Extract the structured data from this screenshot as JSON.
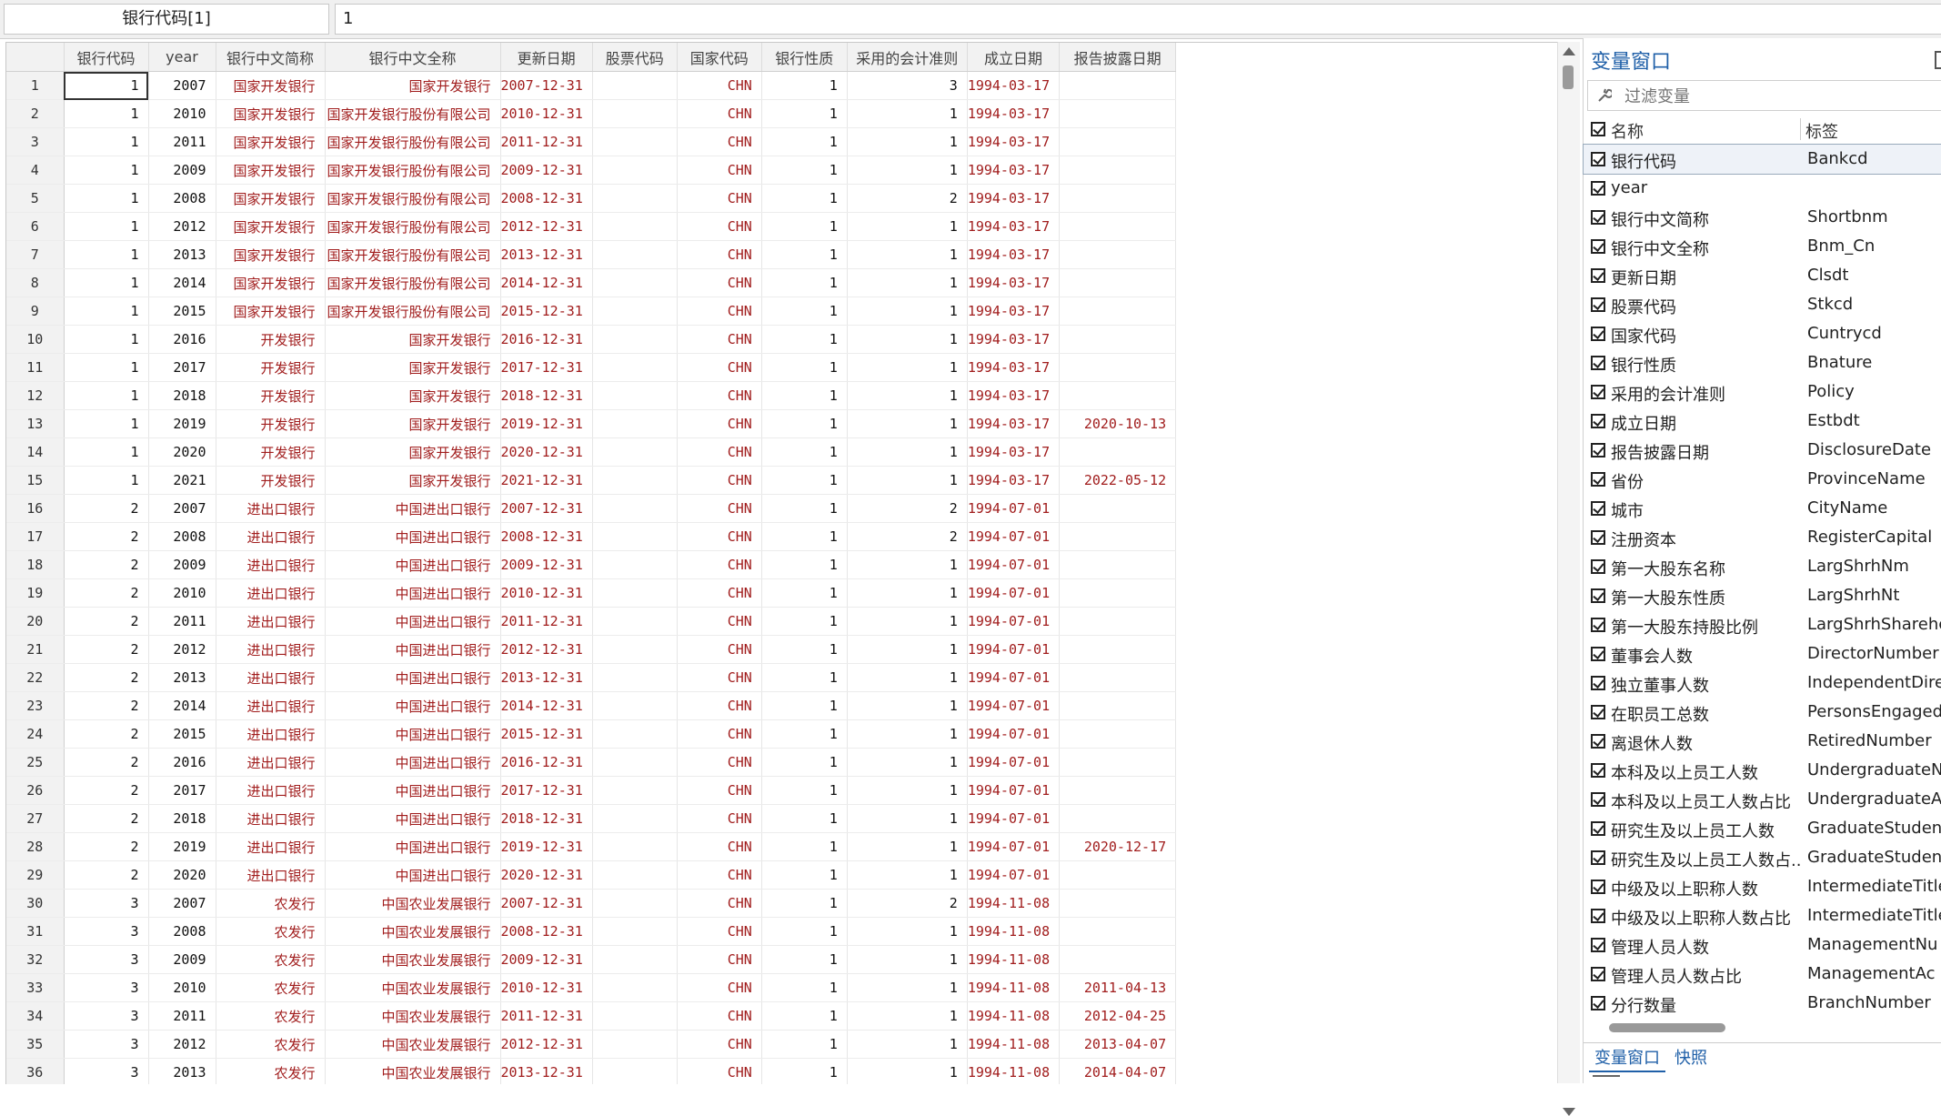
{
  "varbar": {
    "name": "银行代码[1]",
    "value": "1"
  },
  "columns": [
    "银行代码",
    "year",
    "银行中文简称",
    "银行中文全称",
    "更新日期",
    "股票代码",
    "国家代码",
    "银行性质",
    "采用的会计准则",
    "成立日期",
    "报告披露日期"
  ],
  "rows": [
    [
      "1",
      "1",
      "2007",
      "国家开发银行",
      "国家开发银行",
      "2007-12-31",
      "",
      "CHN",
      "1",
      "3",
      "1994-03-17",
      ""
    ],
    [
      "2",
      "1",
      "2010",
      "国家开发银行",
      "国家开发银行股份有限公司",
      "2010-12-31",
      "",
      "CHN",
      "1",
      "1",
      "1994-03-17",
      ""
    ],
    [
      "3",
      "1",
      "2011",
      "国家开发银行",
      "国家开发银行股份有限公司",
      "2011-12-31",
      "",
      "CHN",
      "1",
      "1",
      "1994-03-17",
      ""
    ],
    [
      "4",
      "1",
      "2009",
      "国家开发银行",
      "国家开发银行股份有限公司",
      "2009-12-31",
      "",
      "CHN",
      "1",
      "1",
      "1994-03-17",
      ""
    ],
    [
      "5",
      "1",
      "2008",
      "国家开发银行",
      "国家开发银行股份有限公司",
      "2008-12-31",
      "",
      "CHN",
      "1",
      "2",
      "1994-03-17",
      ""
    ],
    [
      "6",
      "1",
      "2012",
      "国家开发银行",
      "国家开发银行股份有限公司",
      "2012-12-31",
      "",
      "CHN",
      "1",
      "1",
      "1994-03-17",
      ""
    ],
    [
      "7",
      "1",
      "2013",
      "国家开发银行",
      "国家开发银行股份有限公司",
      "2013-12-31",
      "",
      "CHN",
      "1",
      "1",
      "1994-03-17",
      ""
    ],
    [
      "8",
      "1",
      "2014",
      "国家开发银行",
      "国家开发银行股份有限公司",
      "2014-12-31",
      "",
      "CHN",
      "1",
      "1",
      "1994-03-17",
      ""
    ],
    [
      "9",
      "1",
      "2015",
      "国家开发银行",
      "国家开发银行股份有限公司",
      "2015-12-31",
      "",
      "CHN",
      "1",
      "1",
      "1994-03-17",
      ""
    ],
    [
      "10",
      "1",
      "2016",
      "开发银行",
      "国家开发银行",
      "2016-12-31",
      "",
      "CHN",
      "1",
      "1",
      "1994-03-17",
      ""
    ],
    [
      "11",
      "1",
      "2017",
      "开发银行",
      "国家开发银行",
      "2017-12-31",
      "",
      "CHN",
      "1",
      "1",
      "1994-03-17",
      ""
    ],
    [
      "12",
      "1",
      "2018",
      "开发银行",
      "国家开发银行",
      "2018-12-31",
      "",
      "CHN",
      "1",
      "1",
      "1994-03-17",
      ""
    ],
    [
      "13",
      "1",
      "2019",
      "开发银行",
      "国家开发银行",
      "2019-12-31",
      "",
      "CHN",
      "1",
      "1",
      "1994-03-17",
      "2020-10-13"
    ],
    [
      "14",
      "1",
      "2020",
      "开发银行",
      "国家开发银行",
      "2020-12-31",
      "",
      "CHN",
      "1",
      "1",
      "1994-03-17",
      ""
    ],
    [
      "15",
      "1",
      "2021",
      "开发银行",
      "国家开发银行",
      "2021-12-31",
      "",
      "CHN",
      "1",
      "1",
      "1994-03-17",
      "2022-05-12"
    ],
    [
      "16",
      "2",
      "2007",
      "进出口银行",
      "中国进出口银行",
      "2007-12-31",
      "",
      "CHN",
      "1",
      "2",
      "1994-07-01",
      ""
    ],
    [
      "17",
      "2",
      "2008",
      "进出口银行",
      "中国进出口银行",
      "2008-12-31",
      "",
      "CHN",
      "1",
      "2",
      "1994-07-01",
      ""
    ],
    [
      "18",
      "2",
      "2009",
      "进出口银行",
      "中国进出口银行",
      "2009-12-31",
      "",
      "CHN",
      "1",
      "1",
      "1994-07-01",
      ""
    ],
    [
      "19",
      "2",
      "2010",
      "进出口银行",
      "中国进出口银行",
      "2010-12-31",
      "",
      "CHN",
      "1",
      "1",
      "1994-07-01",
      ""
    ],
    [
      "20",
      "2",
      "2011",
      "进出口银行",
      "中国进出口银行",
      "2011-12-31",
      "",
      "CHN",
      "1",
      "1",
      "1994-07-01",
      ""
    ],
    [
      "21",
      "2",
      "2012",
      "进出口银行",
      "中国进出口银行",
      "2012-12-31",
      "",
      "CHN",
      "1",
      "1",
      "1994-07-01",
      ""
    ],
    [
      "22",
      "2",
      "2013",
      "进出口银行",
      "中国进出口银行",
      "2013-12-31",
      "",
      "CHN",
      "1",
      "1",
      "1994-07-01",
      ""
    ],
    [
      "23",
      "2",
      "2014",
      "进出口银行",
      "中国进出口银行",
      "2014-12-31",
      "",
      "CHN",
      "1",
      "1",
      "1994-07-01",
      ""
    ],
    [
      "24",
      "2",
      "2015",
      "进出口银行",
      "中国进出口银行",
      "2015-12-31",
      "",
      "CHN",
      "1",
      "1",
      "1994-07-01",
      ""
    ],
    [
      "25",
      "2",
      "2016",
      "进出口银行",
      "中国进出口银行",
      "2016-12-31",
      "",
      "CHN",
      "1",
      "1",
      "1994-07-01",
      ""
    ],
    [
      "26",
      "2",
      "2017",
      "进出口银行",
      "中国进出口银行",
      "2017-12-31",
      "",
      "CHN",
      "1",
      "1",
      "1994-07-01",
      ""
    ],
    [
      "27",
      "2",
      "2018",
      "进出口银行",
      "中国进出口银行",
      "2018-12-31",
      "",
      "CHN",
      "1",
      "1",
      "1994-07-01",
      ""
    ],
    [
      "28",
      "2",
      "2019",
      "进出口银行",
      "中国进出口银行",
      "2019-12-31",
      "",
      "CHN",
      "1",
      "1",
      "1994-07-01",
      "2020-12-17"
    ],
    [
      "29",
      "2",
      "2020",
      "进出口银行",
      "中国进出口银行",
      "2020-12-31",
      "",
      "CHN",
      "1",
      "1",
      "1994-07-01",
      ""
    ],
    [
      "30",
      "3",
      "2007",
      "农发行",
      "中国农业发展银行",
      "2007-12-31",
      "",
      "CHN",
      "1",
      "2",
      "1994-11-08",
      ""
    ],
    [
      "31",
      "3",
      "2008",
      "农发行",
      "中国农业发展银行",
      "2008-12-31",
      "",
      "CHN",
      "1",
      "1",
      "1994-11-08",
      ""
    ],
    [
      "32",
      "3",
      "2009",
      "农发行",
      "中国农业发展银行",
      "2009-12-31",
      "",
      "CHN",
      "1",
      "1",
      "1994-11-08",
      ""
    ],
    [
      "33",
      "3",
      "2010",
      "农发行",
      "中国农业发展银行",
      "2010-12-31",
      "",
      "CHN",
      "1",
      "1",
      "1994-11-08",
      "2011-04-13"
    ],
    [
      "34",
      "3",
      "2011",
      "农发行",
      "中国农业发展银行",
      "2011-12-31",
      "",
      "CHN",
      "1",
      "1",
      "1994-11-08",
      "2012-04-25"
    ],
    [
      "35",
      "3",
      "2012",
      "农发行",
      "中国农业发展银行",
      "2012-12-31",
      "",
      "CHN",
      "1",
      "1",
      "1994-11-08",
      "2013-04-07"
    ],
    [
      "36",
      "3",
      "2013",
      "农发行",
      "中国农业发展银行",
      "2013-12-31",
      "",
      "CHN",
      "1",
      "1",
      "1994-11-08",
      "2014-04-07"
    ]
  ],
  "panel": {
    "title": "变量窗口",
    "filter_placeholder": "过滤变量",
    "header_name": "名称",
    "header_label": "标签",
    "variables": [
      {
        "name": "银行代码",
        "label": "Bankcd"
      },
      {
        "name": "year",
        "label": ""
      },
      {
        "name": "银行中文简称",
        "label": "Shortbnm"
      },
      {
        "name": "银行中文全称",
        "label": "Bnm_Cn"
      },
      {
        "name": "更新日期",
        "label": "Clsdt"
      },
      {
        "name": "股票代码",
        "label": "Stkcd"
      },
      {
        "name": "国家代码",
        "label": "Cuntrycd"
      },
      {
        "name": "银行性质",
        "label": "Bnature"
      },
      {
        "name": "采用的会计准则",
        "label": "Policy"
      },
      {
        "name": "成立日期",
        "label": "Estbdt"
      },
      {
        "name": "报告披露日期",
        "label": "DisclosureDate"
      },
      {
        "name": "省份",
        "label": "ProvinceName"
      },
      {
        "name": "城市",
        "label": "CityName"
      },
      {
        "name": "注册资本",
        "label": "RegisterCapital"
      },
      {
        "name": "第一大股东名称",
        "label": "LargShrhNm"
      },
      {
        "name": "第一大股东性质",
        "label": "LargShrhNt"
      },
      {
        "name": "第一大股东持股比例",
        "label": "LargShrhSharehc"
      },
      {
        "name": "董事会人数",
        "label": "DirectorNumber"
      },
      {
        "name": "独立董事人数",
        "label": "IndependentDire"
      },
      {
        "name": "在职员工总数",
        "label": "PersonsEngaged"
      },
      {
        "name": "离退休人数",
        "label": "RetiredNumber"
      },
      {
        "name": "本科及以上员工人数",
        "label": "UndergraduateN"
      },
      {
        "name": "本科及以上员工人数占比",
        "label": "UndergraduateA"
      },
      {
        "name": "研究生及以上员工人数",
        "label": "GraduateStuden"
      },
      {
        "name": "研究生及以上员工人数占...",
        "label": "GraduateStuden"
      },
      {
        "name": "中级及以上职称人数",
        "label": "IntermediateTitle"
      },
      {
        "name": "中级及以上职称人数占比",
        "label": "IntermediateTitle"
      },
      {
        "name": "管理人员人数",
        "label": "ManagementNu"
      },
      {
        "name": "管理人员人数占比",
        "label": "ManagementAc"
      },
      {
        "name": "分行数量",
        "label": "BranchNumber"
      }
    ],
    "tabs": [
      "变量窗口",
      "快照"
    ]
  },
  "colors": {
    "string_text": "#a11d1d",
    "panel_accent": "#2060a8"
  }
}
